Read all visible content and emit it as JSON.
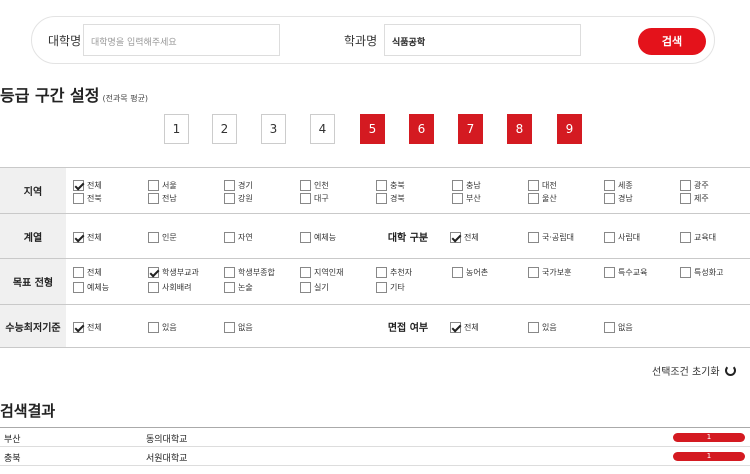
{
  "search": {
    "university_label": "대학명",
    "university_placeholder": "대학명을 입력해주세요",
    "department_label": "학과명",
    "department_value": "식품공학",
    "button_label": "검색"
  },
  "grade": {
    "title": "등급 구간 설정",
    "subtitle": "(전과목 평균)",
    "items": [
      {
        "label": "1",
        "selected": false
      },
      {
        "label": "2",
        "selected": false
      },
      {
        "label": "3",
        "selected": false
      },
      {
        "label": "4",
        "selected": false
      },
      {
        "label": "5",
        "selected": true
      },
      {
        "label": "6",
        "selected": true
      },
      {
        "label": "7",
        "selected": true
      },
      {
        "label": "8",
        "selected": true
      },
      {
        "label": "9",
        "selected": true
      }
    ],
    "selected_color": "#d41a21"
  },
  "filters": {
    "region": {
      "label": "지역",
      "options": [
        {
          "label": "전체",
          "checked": true
        },
        {
          "label": "서울",
          "checked": false
        },
        {
          "label": "경기",
          "checked": false
        },
        {
          "label": "인천",
          "checked": false
        },
        {
          "label": "충북",
          "checked": false
        },
        {
          "label": "충남",
          "checked": false
        },
        {
          "label": "대전",
          "checked": false
        },
        {
          "label": "세종",
          "checked": false
        },
        {
          "label": "광주",
          "checked": false
        },
        {
          "label": "전북",
          "checked": false
        },
        {
          "label": "전남",
          "checked": false
        },
        {
          "label": "강원",
          "checked": false
        },
        {
          "label": "대구",
          "checked": false
        },
        {
          "label": "경북",
          "checked": false
        },
        {
          "label": "부산",
          "checked": false
        },
        {
          "label": "울산",
          "checked": false
        },
        {
          "label": "경남",
          "checked": false
        },
        {
          "label": "제주",
          "checked": false
        }
      ]
    },
    "track": {
      "label": "계열",
      "options": [
        {
          "label": "전체",
          "checked": true
        },
        {
          "label": "인문",
          "checked": false
        },
        {
          "label": "자연",
          "checked": false
        },
        {
          "label": "예체능",
          "checked": false
        }
      ]
    },
    "univ_type": {
      "label": "대학 구분",
      "options": [
        {
          "label": "전체",
          "checked": true
        },
        {
          "label": "국·공립대",
          "checked": false
        },
        {
          "label": "사립대",
          "checked": false
        },
        {
          "label": "교육대",
          "checked": false
        }
      ]
    },
    "admission": {
      "label": "목표 전형",
      "options": [
        {
          "label": "전체",
          "checked": false
        },
        {
          "label": "학생부교과",
          "checked": true
        },
        {
          "label": "학생부종합",
          "checked": false
        },
        {
          "label": "지역인재",
          "checked": false
        },
        {
          "label": "추천자",
          "checked": false
        },
        {
          "label": "농어촌",
          "checked": false
        },
        {
          "label": "국가보훈",
          "checked": false
        },
        {
          "label": "특수교육",
          "checked": false
        },
        {
          "label": "특성화고",
          "checked": false
        },
        {
          "label": "예체능",
          "checked": false
        },
        {
          "label": "사회배려",
          "checked": false
        },
        {
          "label": "논술",
          "checked": false
        },
        {
          "label": "실기",
          "checked": false
        },
        {
          "label": "기타",
          "checked": false
        }
      ]
    },
    "csat_min": {
      "label": "수능최저기준",
      "options": [
        {
          "label": "전체",
          "checked": true
        },
        {
          "label": "있음",
          "checked": false
        },
        {
          "label": "없음",
          "checked": false
        }
      ]
    },
    "interview": {
      "label": "면접 여부",
      "options": [
        {
          "label": "전체",
          "checked": true
        },
        {
          "label": "있음",
          "checked": false
        },
        {
          "label": "없음",
          "checked": false
        }
      ]
    }
  },
  "reset_label": "선택조건 초기화",
  "results": {
    "title": "검색결과",
    "rows": [
      {
        "region": "부산",
        "university": "동의대학교",
        "badge": "1"
      },
      {
        "region": "충북",
        "university": "서원대학교",
        "badge": "1"
      }
    ],
    "badge_color": "#d41a21"
  }
}
